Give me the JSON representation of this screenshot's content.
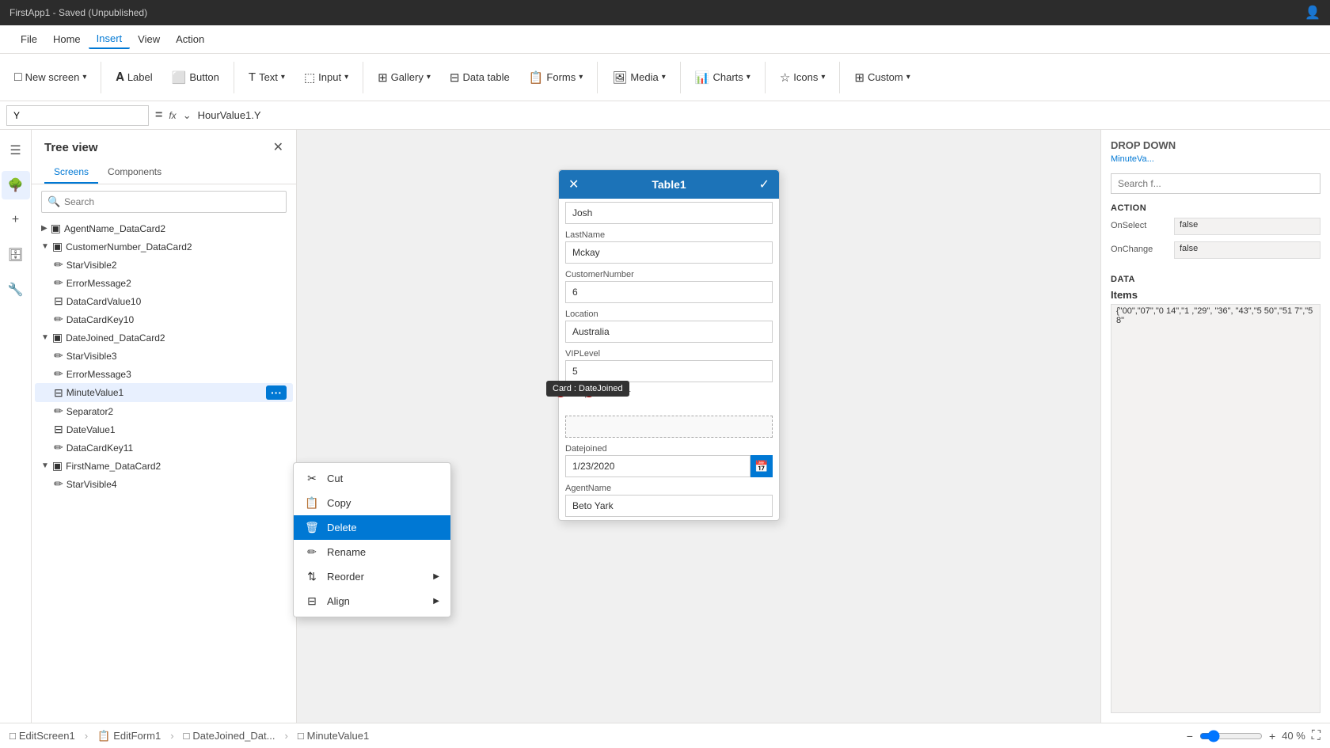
{
  "titlebar": {
    "app_title": "FirstApp1 - Saved (Unpublished)",
    "user_icon": "👤"
  },
  "menubar": {
    "items": [
      {
        "id": "file",
        "label": "File"
      },
      {
        "id": "home",
        "label": "Home"
      },
      {
        "id": "insert",
        "label": "Insert",
        "active": true
      },
      {
        "id": "view",
        "label": "View"
      },
      {
        "id": "action",
        "label": "Action"
      }
    ]
  },
  "ribbon": {
    "new_screen_label": "New screen",
    "label_label": "Label",
    "button_label": "Button",
    "text_label": "Text",
    "input_label": "Input",
    "gallery_label": "Gallery",
    "datatable_label": "Data table",
    "forms_label": "Forms",
    "media_label": "Media",
    "charts_label": "Charts",
    "icons_label": "Icons",
    "custom_label": "Custom"
  },
  "formulabar": {
    "name_value": "Y",
    "eq_symbol": "=",
    "fx_label": "fx",
    "formula_value": "HourValue1.Y"
  },
  "treepanel": {
    "title": "Tree view",
    "close_icon": "✕",
    "tabs": [
      {
        "id": "screens",
        "label": "Screens",
        "active": true
      },
      {
        "id": "components",
        "label": "Components"
      }
    ],
    "search_placeholder": "Search",
    "items": [
      {
        "id": "agentname",
        "label": "AgentName_DataCard2",
        "indent": 0,
        "type": "card",
        "expanded": false
      },
      {
        "id": "customernumber",
        "label": "CustomerNumber_DataCard2",
        "indent": 0,
        "type": "card",
        "expanded": true
      },
      {
        "id": "starvisible2",
        "label": "StarVisible2",
        "indent": 1,
        "type": "edit"
      },
      {
        "id": "errormessage2",
        "label": "ErrorMessage2",
        "indent": 1,
        "type": "edit"
      },
      {
        "id": "datacardvalue10",
        "label": "DataCardValue10",
        "indent": 1,
        "type": "layout"
      },
      {
        "id": "datacardkey10",
        "label": "DataCardKey10",
        "indent": 1,
        "type": "edit"
      },
      {
        "id": "datejoined",
        "label": "DateJoined_DataCard2",
        "indent": 0,
        "type": "card",
        "expanded": true
      },
      {
        "id": "starvisible3",
        "label": "StarVisible3",
        "indent": 1,
        "type": "edit"
      },
      {
        "id": "errormessage3",
        "label": "ErrorMessage3",
        "indent": 1,
        "type": "edit"
      },
      {
        "id": "minutevalue1",
        "label": "MinuteValue1",
        "indent": 1,
        "type": "layout",
        "selected": true,
        "hasDots": true
      },
      {
        "id": "separator2",
        "label": "Separator2",
        "indent": 1,
        "type": "edit"
      },
      {
        "id": "datevalue1",
        "label": "DateValue1",
        "indent": 1,
        "type": "layout"
      },
      {
        "id": "datacardkey11",
        "label": "DataCardKey11",
        "indent": 1,
        "type": "edit"
      },
      {
        "id": "firstname",
        "label": "FirstName_DataCard2",
        "indent": 0,
        "type": "card",
        "expanded": true
      },
      {
        "id": "starvisible4",
        "label": "StarVisible4",
        "indent": 1,
        "type": "edit"
      }
    ]
  },
  "context_menu": {
    "items": [
      {
        "id": "cut",
        "label": "Cut",
        "icon": "✂"
      },
      {
        "id": "copy",
        "label": "Copy",
        "icon": "📋"
      },
      {
        "id": "delete",
        "label": "Delete",
        "icon": "🗑",
        "highlighted": true
      },
      {
        "id": "rename",
        "label": "Rename",
        "icon": "✏"
      },
      {
        "id": "reorder",
        "label": "Reorder",
        "icon": "⇅",
        "hasArrow": true
      },
      {
        "id": "align",
        "label": "Align",
        "icon": "⊟",
        "hasArrow": true
      }
    ]
  },
  "table_dialog": {
    "title": "Table1",
    "fields": [
      {
        "id": "firstname",
        "label": null,
        "value": "Josh"
      },
      {
        "id": "lastname",
        "label": "LastName",
        "value": "Mckay"
      },
      {
        "id": "customernumber",
        "label": "CustomerNumber",
        "value": "6"
      },
      {
        "id": "location",
        "label": "Location",
        "value": "Australia"
      },
      {
        "id": "viplevel",
        "label": "VIPLevel",
        "value": "5"
      },
      {
        "id": "passportnumber",
        "label": "PassportNumber",
        "value": "",
        "tooltip": "Card : DateJoined"
      },
      {
        "id": "datejoined",
        "label": "Datejoined",
        "value": "1/23/2020",
        "isDate": true
      },
      {
        "id": "agentname",
        "label": "AgentName",
        "value": "Beto Yark"
      }
    ]
  },
  "right_panel": {
    "drop_down_label": "DROP DOWN",
    "minute_value_label": "MinuteVa...",
    "search_placeholder": "Search f...",
    "action_section": "ACTION",
    "onselect_label": "OnSelect",
    "onselect_value": "false",
    "onchange_label": "OnChange",
    "onchange_value": "false",
    "data_section": "DATA",
    "items_label": "Items",
    "items_value": "{\"00\",\"07\",\"0 14\",\"1 ,\"29\", \"36\", \"43\",\"5 50\",\"51 7\",\"58\""
  },
  "statusbar": {
    "breadcrumbs": [
      {
        "id": "editscreen1",
        "icon": "□",
        "label": "EditScreen1"
      },
      {
        "id": "editform1",
        "icon": "📋",
        "label": "EditForm1"
      },
      {
        "id": "datejoined_dat",
        "icon": "□",
        "label": "DateJoined_Dat..."
      },
      {
        "id": "minutevalue1",
        "icon": "□",
        "label": "MinuteValue1"
      }
    ],
    "zoom_minus": "−",
    "zoom_plus": "+",
    "zoom_level": "40 %",
    "fullscreen_icon": "⛶"
  }
}
